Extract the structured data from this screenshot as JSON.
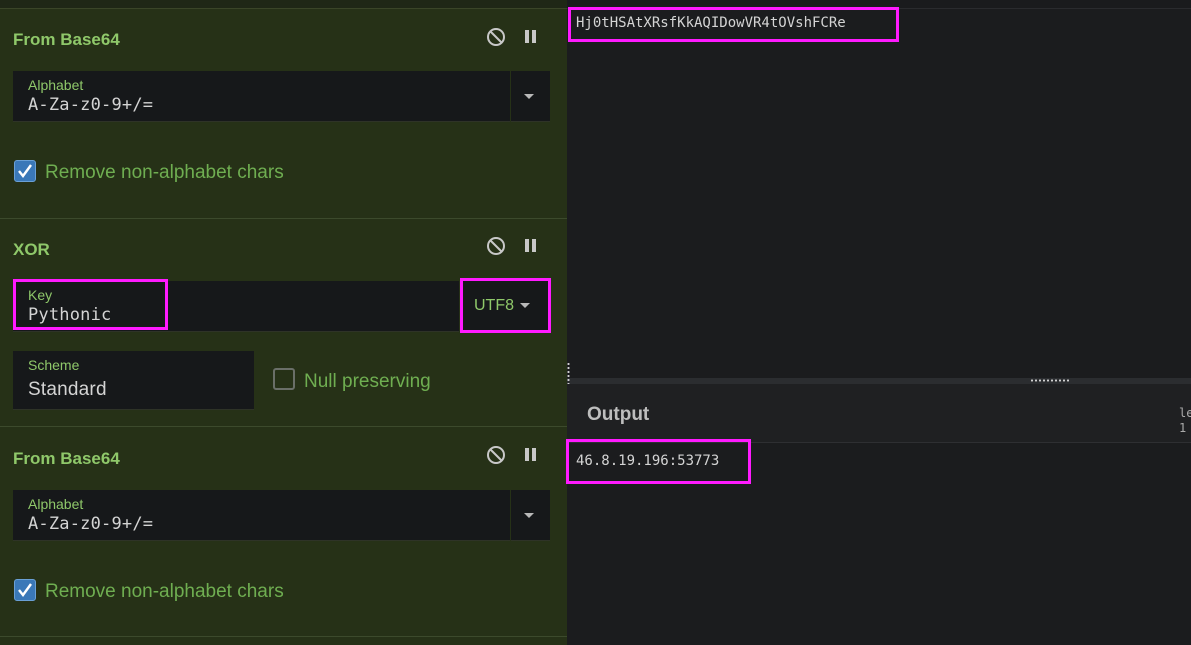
{
  "recipe": {
    "operations": [
      {
        "title": "From Base64",
        "alphabet_label": "Alphabet",
        "alphabet_value": "A-Za-z0-9+/=",
        "remove_label": "Remove non-alphabet chars",
        "remove_checked": true
      },
      {
        "title": "XOR",
        "key_label": "Key",
        "key_value": "Pythonic",
        "encoding": "UTF8",
        "scheme_label": "Scheme",
        "scheme_value": "Standard",
        "null_label": "Null preserving",
        "null_checked": false
      },
      {
        "title": "From Base64",
        "alphabet_label": "Alphabet",
        "alphabet_value": "A-Za-z0-9+/=",
        "remove_label": "Remove non-alphabet chars",
        "remove_checked": true
      }
    ]
  },
  "input": {
    "text": "Hj0tHSAtXRsfKkAQIDowVR4tOVshFCRe"
  },
  "output": {
    "title": "Output",
    "meta_line1": "le",
    "meta_line2": "1",
    "text": "46.8.19.196:53773"
  },
  "colors": {
    "highlight": "#ff1aff",
    "recipe_bg": "#263117",
    "accent_green": "#8fc86a",
    "checkbox_blue": "#3a78b8"
  }
}
